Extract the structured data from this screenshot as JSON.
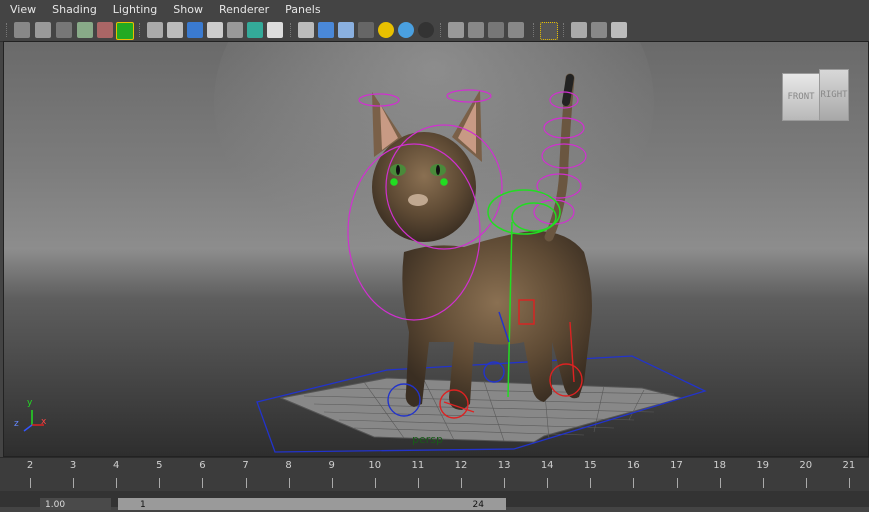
{
  "menubar": {
    "items": [
      "View",
      "Shading",
      "Lighting",
      "Show",
      "Renderer",
      "Panels"
    ]
  },
  "toolbar": {
    "icons": [
      "camera-attributes-icon",
      "bookmarks-icon",
      "image-plane-icon",
      "two-d-pan-icon",
      "grease-pencil-icon",
      "film-gate-icon",
      "wireframe-icon",
      "smooth-shade-icon",
      "isolate-select-icon",
      "x-ray-icon",
      "resolution-gate-icon",
      "text-icon",
      "grid-icon",
      "bounding-box-icon",
      "flat-shade-icon",
      "textured-icon",
      "lights-icon",
      "shadows-icon",
      "screen-space-ao-icon",
      "motion-blur-icon",
      "anti-aliasing-icon",
      "depth-of-field-icon",
      "select-camera-icon",
      "single-view-icon",
      "two-panes-icon",
      "node-editor-icon"
    ]
  },
  "viewport": {
    "camera_label": "persp",
    "viewcube": {
      "front": "FRONT",
      "right": "RIGHT"
    },
    "axis": {
      "x": "x",
      "y": "y",
      "z": "z"
    }
  },
  "timeline": {
    "ticks": [
      "2",
      "3",
      "4",
      "5",
      "6",
      "7",
      "8",
      "9",
      "10",
      "11",
      "12",
      "13",
      "14",
      "15",
      "16",
      "17",
      "18",
      "19",
      "20",
      "21"
    ]
  },
  "range": {
    "start_value": "1.00",
    "slider_start": "1",
    "slider_end": "24"
  },
  "colors": {
    "ui_bg": "#444444",
    "rig_magenta": "#d030d0",
    "rig_green": "#22dd22",
    "rig_red": "#dd2222",
    "rig_blue": "#2233cc"
  }
}
